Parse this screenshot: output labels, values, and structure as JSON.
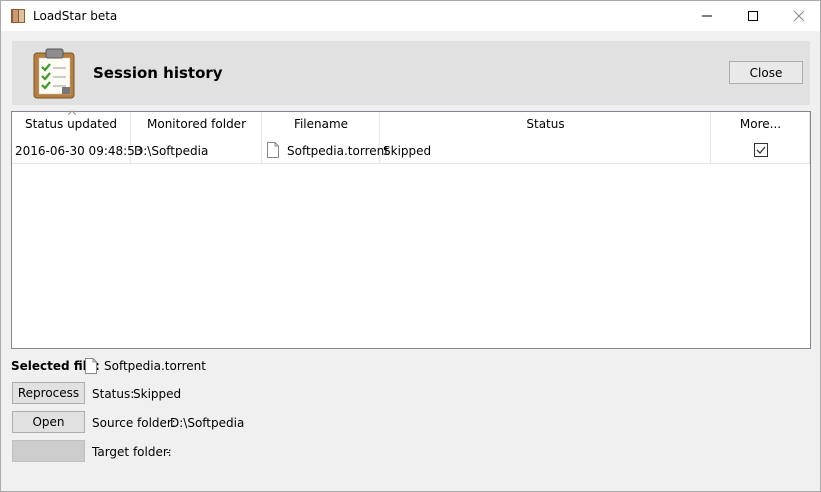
{
  "window": {
    "title": "LoadStar beta"
  },
  "header": {
    "title": "Session history",
    "close_label": "Close"
  },
  "table": {
    "columns": [
      "Status updated",
      "Monitored folder",
      "Filename",
      "Status",
      "More..."
    ],
    "rows": [
      {
        "status_updated": "2016-06-30 09:48:53",
        "monitored_folder": "D:\\Softpedia",
        "filename": "Softpedia.torrent",
        "status": "Skipped",
        "more_checked": true
      }
    ]
  },
  "details": {
    "selected_file_label": "Selected file:",
    "selected_file_value": "Softpedia.torrent",
    "reprocess_label": "Reprocess",
    "status_label": "Status:",
    "status_value": "Skipped",
    "open_label": "Open",
    "source_folder_label": "Source folder:",
    "source_folder_value": "D:\\Softpedia",
    "target_folder_label": "Target folder:",
    "target_folder_value": "-"
  },
  "icons": {
    "app": "app-book-icon",
    "header": "clipboard-checklist-icon",
    "file": "file-icon",
    "minimize": "minimize-icon",
    "maximize": "maximize-icon",
    "close": "close-icon",
    "checkbox": "checkbox-checked-icon"
  }
}
